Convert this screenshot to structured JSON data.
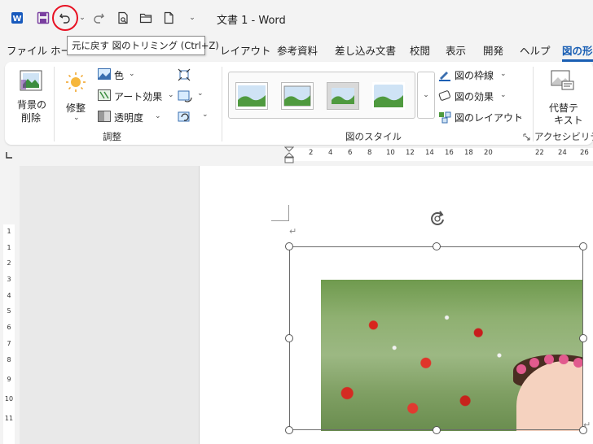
{
  "titlebar": {
    "title": "文書 1  -  Word",
    "app_icon": "word-icon"
  },
  "tooltip": {
    "text": "元に戻す 図のトリミング (Ctrl+Z)"
  },
  "tabs": [
    {
      "label": "ファイル"
    },
    {
      "label": "ホー"
    },
    {
      "label": "レイアウト"
    },
    {
      "label": "参考資料"
    },
    {
      "label": "差し込み文書"
    },
    {
      "label": "校閲"
    },
    {
      "label": "表示"
    },
    {
      "label": "開発"
    },
    {
      "label": "ヘルプ"
    },
    {
      "label": "図の形"
    }
  ],
  "ribbon": {
    "remove_bg": {
      "line1": "背景の",
      "line2": "削除"
    },
    "corrections": {
      "label": "修整"
    },
    "color": {
      "label": "色"
    },
    "artistic": {
      "label": "アート効果"
    },
    "transparency": {
      "label": "透明度"
    },
    "adjust_group": "調整",
    "styles_group": "図のスタイル",
    "border": {
      "label": "図の枠線"
    },
    "effects": {
      "label": "図の効果"
    },
    "layout": {
      "label": "図のレイアウト"
    },
    "alt_text": {
      "line1": "代替テ",
      "line2": "キスト"
    },
    "accessibility_group": "アクセシビリティ"
  },
  "ruler": {
    "ticks": [
      "2",
      "4",
      "6",
      "8",
      "10",
      "12",
      "14",
      "16",
      "18",
      "20",
      "22",
      "24",
      "26"
    ],
    "vticks": [
      "1",
      "1",
      "2",
      "3",
      "4",
      "5",
      "6",
      "7",
      "8",
      "9",
      "10",
      "11"
    ]
  },
  "colors": {
    "accent": "#1a5fb4",
    "word_blue": "#185abd",
    "annotation_red": "#e81123"
  }
}
